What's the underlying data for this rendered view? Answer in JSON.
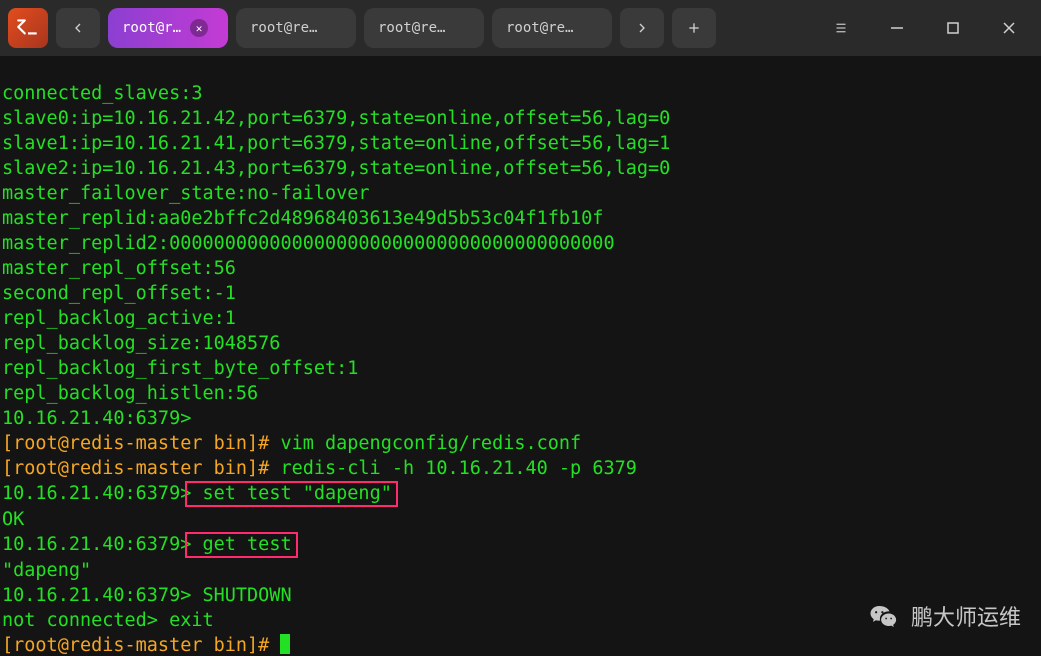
{
  "titlebar": {
    "tabs": [
      {
        "label": "root@re···",
        "active": true
      },
      {
        "label": "root@re···",
        "active": false
      },
      {
        "label": "root@re···",
        "active": false
      },
      {
        "label": "root@re···",
        "active": false
      }
    ]
  },
  "terminal": {
    "lines": [
      {
        "t": "connected_slaves:3"
      },
      {
        "t": "slave0:ip=10.16.21.42,port=6379,state=online,offset=56,lag=0"
      },
      {
        "t": "slave1:ip=10.16.21.41,port=6379,state=online,offset=56,lag=1"
      },
      {
        "t": "slave2:ip=10.16.21.43,port=6379,state=online,offset=56,lag=0"
      },
      {
        "t": "master_failover_state:no-failover"
      },
      {
        "t": "master_replid:aa0e2bffc2d48968403613e49d5b53c04f1fb10f"
      },
      {
        "t": "master_replid2:0000000000000000000000000000000000000000"
      },
      {
        "t": "master_repl_offset:56"
      },
      {
        "t": "second_repl_offset:-1"
      },
      {
        "t": "repl_backlog_active:1"
      },
      {
        "t": "repl_backlog_size:1048576"
      },
      {
        "t": "repl_backlog_first_byte_offset:1"
      },
      {
        "t": "repl_backlog_histlen:56"
      },
      {
        "t": "10.16.21.40:6379>"
      }
    ],
    "prompt1_user": "[root@redis-master bin]# ",
    "prompt1_cmd": "vim dapengconfig/redis.conf",
    "prompt2_user": "[root@redis-master bin]# ",
    "prompt2_cmd": "redis-cli -h 10.16.21.40 -p 6379",
    "redis_set_prompt": "10.16.21.40:6379>",
    "redis_set_cmd": " set test \"dapeng\"",
    "ok": "OK",
    "redis_get_prompt": "10.16.21.40:6379>",
    "redis_get_cmd": " get test",
    "get_result": "\"dapeng\"",
    "shutdown_prompt": "10.16.21.40:6379> ",
    "shutdown_cmd": "SHUTDOWN",
    "notconn": "not connected> ",
    "exit": "exit",
    "final_prompt": "[root@redis-master bin]# "
  },
  "watermark": {
    "text": "鹏大师运维"
  }
}
